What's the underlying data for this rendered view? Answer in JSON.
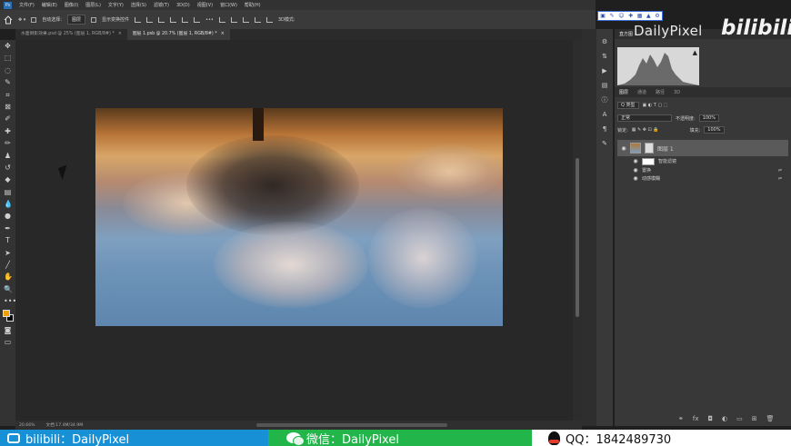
{
  "menu": {
    "items": [
      "文件(F)",
      "编辑(E)",
      "图像(I)",
      "图层(L)",
      "文字(Y)",
      "选择(S)",
      "滤镜(T)",
      "3D(D)",
      "视图(V)",
      "窗口(W)",
      "帮助(H)"
    ]
  },
  "options": {
    "auto_select_label": "自动选择:",
    "auto_select_value": "图层",
    "show_transform_label": "显示变换控件"
  },
  "tabs": [
    {
      "label": "水面倒影效果.psd @ 25% (图层 1, RGB/8#) *",
      "close": "×"
    },
    {
      "label": "图层 1.psb @ 20.7% (图层 1, RGB/8#) *",
      "close": "×"
    }
  ],
  "status": {
    "zoom": "20.66%",
    "doc": "文档:17.4M/34.9M"
  },
  "panels": {
    "top_tabs": [
      "直方图"
    ],
    "layers_tabs": [
      "图层",
      "通道",
      "路径",
      "3D"
    ],
    "filter_kind": "Q 类型",
    "blend_mode": "正常",
    "opacity_label": "不透明度:",
    "opacity_value": "100%",
    "lock_label": "锁定:",
    "fill_label": "填充:",
    "fill_value": "100%"
  },
  "layers": [
    {
      "name": "图层 1"
    },
    {
      "name": "智能滤镜"
    },
    {
      "name": "置换"
    },
    {
      "name": "动感模糊"
    }
  ],
  "watermark": {
    "channel": "DailyPixel",
    "site_logo": "bilibili"
  },
  "banner": {
    "bili": "bilibili：DailyPixel",
    "wechat": "微信：DailyPixel",
    "qq": "QQ：1842489730",
    "colors": {
      "bili": "#1890d6",
      "wechat": "#21b54a",
      "qq": "#ffffff"
    }
  }
}
